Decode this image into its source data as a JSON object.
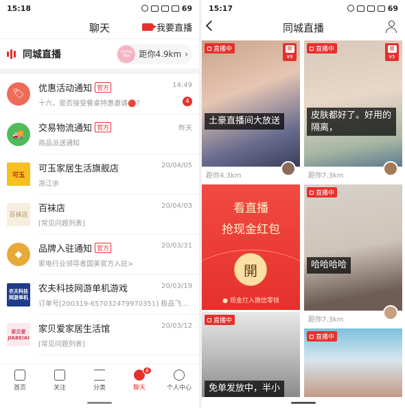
{
  "left": {
    "status": {
      "time": "15:18",
      "battery": "69"
    },
    "title": "聊天",
    "live_button": "我要直播",
    "local_live": {
      "title": "同城直播",
      "distance": "距你4.9km",
      "avatar_text": "mima like"
    },
    "messages": [
      {
        "name": "优惠活动通知",
        "tag": "官方",
        "sub": "十六，是否接受餐桌特惠邀请🔴？",
        "time": "14:49",
        "badge": "4",
        "avatar_color": "#ee6b58",
        "avatar_text": "🏷"
      },
      {
        "name": "交易物流通知",
        "tag": "官方",
        "sub": "商品派送通知",
        "time": "昨天",
        "badge": "",
        "avatar_color": "#4fbb5a",
        "avatar_text": "🚚"
      },
      {
        "name": "可玉家居生活旗舰店",
        "tag": "",
        "sub": "浙江余",
        "time": "20/04/05",
        "badge": "",
        "avatar_color": "#f5c020",
        "avatar_text": "可玉"
      },
      {
        "name": "百袜店",
        "tag": "",
        "sub": "[常见问题列表]",
        "time": "20/04/03",
        "badge": "",
        "avatar_color": "#f6efe0",
        "avatar_text": "百袜店"
      },
      {
        "name": "品牌入驻通知",
        "tag": "官方",
        "sub": "家电行业领导者国美官方入驻>",
        "time": "20/03/31",
        "badge": "",
        "avatar_color": "#e8a93b",
        "avatar_text": "◆"
      },
      {
        "name": "农夫科技网游单机游戏",
        "tag": "",
        "sub": "订单号[200319-657032479970351]  极品飞…",
        "time": "20/03/19",
        "badge": "",
        "avatar_color": "#1f3c8a",
        "avatar_text": "农夫科技网游单机"
      },
      {
        "name": "家贝爱家居生活馆",
        "tag": "",
        "sub": "[常见问题列表]",
        "time": "20/03/12",
        "badge": "",
        "avatar_color": "#fbe9ee",
        "avatar_text": "家贝爱 JIABEIAI"
      }
    ],
    "tabs": [
      {
        "label": "首页",
        "badge": ""
      },
      {
        "label": "关注",
        "badge": ""
      },
      {
        "label": "分类",
        "badge": ""
      },
      {
        "label": "聊天",
        "badge": "4"
      },
      {
        "label": "个人中心",
        "badge": ""
      }
    ]
  },
  "right": {
    "status": {
      "time": "15:17",
      "battery": "69"
    },
    "title": "同城直播",
    "cards": [
      {
        "live": "直播中",
        "price": "¥9",
        "caption": "土豪直播间大放送",
        "distance": "距你4.3km"
      },
      {
        "live": "直播中",
        "price": "¥5",
        "caption": "皮肤都好了。好用的隔离，",
        "distance": "距你7.3km"
      },
      {
        "live": "直播中",
        "price": "",
        "caption": "哈哈哈哈",
        "distance": "距你7.3km"
      },
      {
        "live": "直播中",
        "price": "",
        "caption": "免单发放中，半小",
        "distance": ""
      },
      {
        "live": "直播中",
        "price": "",
        "caption": "",
        "distance": ""
      }
    ],
    "red_packet": {
      "line1": "看直播",
      "line2": "抢现金红包",
      "open": "開",
      "footer": "现金打入微信零钱"
    },
    "price_icon": "開"
  },
  "colors": {
    "accent": "#e5302d"
  }
}
